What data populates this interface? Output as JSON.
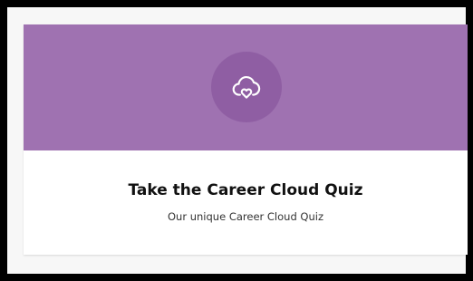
{
  "card": {
    "icon": "cloud-heart-icon",
    "title": "Take the Career Cloud Quiz",
    "subtitle": "Our unique Career Cloud Quiz"
  },
  "colors": {
    "page_border": "#000000",
    "frame_background": "#f7f7f7",
    "banner": "#9f72b1",
    "icon_circle": "#8f5ea3",
    "icon_stroke": "#ffffff",
    "card_background": "#ffffff",
    "title_text": "#111111",
    "subtitle_text": "#333333"
  }
}
